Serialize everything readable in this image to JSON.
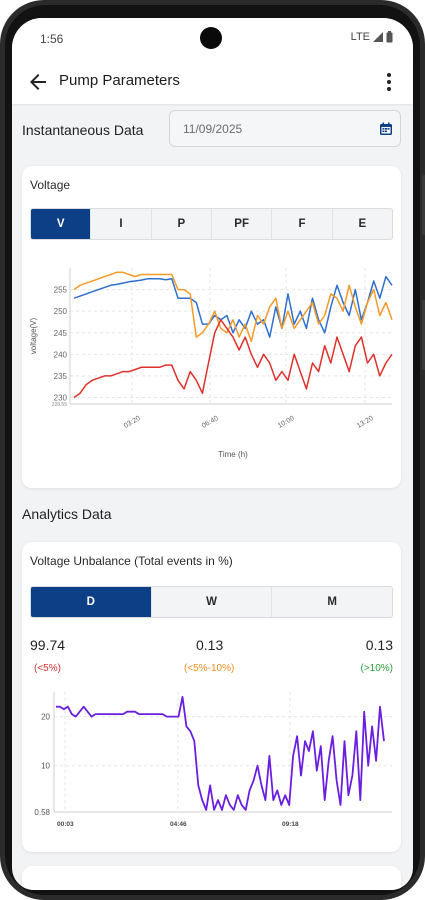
{
  "status_bar": {
    "time": "1:56",
    "network": "LTE"
  },
  "app_bar": {
    "title": "Pump Parameters",
    "back_icon": "arrow-left-icon",
    "menu_icon": "more-vert-icon"
  },
  "instantaneous": {
    "label": "Instantaneous Data",
    "date_value": "11/09/2025",
    "date_icon": "calendar-icon"
  },
  "voltage_card": {
    "title": "Voltage",
    "tabs": [
      "V",
      "I",
      "P",
      "PF",
      "F",
      "E"
    ],
    "active_tab": "V"
  },
  "analytics": {
    "label": "Analytics Data",
    "card_title": "Voltage Unbalance (Total events in %)",
    "tabs": [
      "D",
      "W",
      "M"
    ],
    "active_tab": "D",
    "stats": [
      {
        "value": "99.74",
        "label": "(<5%)",
        "color": "#d32f2f"
      },
      {
        "value": "0.13",
        "label": "(<5%-10%)",
        "color": "#ef8c1e"
      },
      {
        "value": "0.13",
        "label": "(>10%)",
        "color": "#2e9e3a"
      }
    ]
  },
  "chart_data": [
    {
      "type": "line",
      "title": "",
      "xlabel": "Time (h)",
      "ylabel": "voltage(V)",
      "x_tick_labels": [
        "03:20",
        "06:40",
        "10:00",
        "13:20"
      ],
      "y_tick_labels": [
        "230",
        "235",
        "240",
        "245",
        "250",
        "255"
      ],
      "y_min_label": "228.55",
      "ylim": [
        228.5,
        260
      ],
      "grid": true,
      "series": [
        {
          "color": "#2f6fce",
          "values": [
            253,
            253.5,
            254,
            254.5,
            255,
            255.5,
            256,
            256.2,
            256.5,
            256.8,
            257,
            257.2,
            257.5,
            257.5,
            257.5,
            257.3,
            257.5,
            253,
            253,
            253,
            252,
            247,
            247,
            249,
            248,
            249,
            245,
            248,
            246,
            250,
            247,
            248,
            244,
            251,
            246,
            254,
            247,
            250,
            246,
            253,
            248,
            245,
            251,
            256,
            252,
            249,
            255,
            248,
            252,
            257,
            253,
            258,
            256
          ]
        },
        {
          "color": "#f39a28",
          "values": [
            255,
            256,
            256.5,
            257,
            257.5,
            258,
            258.5,
            259,
            259,
            258.5,
            258,
            258.5,
            258.5,
            258.5,
            258.5,
            258.5,
            258.5,
            255,
            255,
            254,
            244,
            245,
            247,
            250,
            246,
            245,
            248,
            244,
            247,
            243,
            249,
            247,
            251,
            253,
            246,
            250,
            246,
            248,
            250,
            252,
            247,
            249,
            254,
            253,
            250,
            256,
            251,
            247,
            252,
            255,
            249,
            252,
            248
          ]
        },
        {
          "color": "#e0302b",
          "values": [
            230,
            231,
            233,
            234,
            234.5,
            235,
            235,
            235.5,
            236,
            236,
            236.5,
            237,
            237,
            237,
            237,
            237.5,
            237.5,
            234,
            232,
            236,
            234,
            231,
            238,
            245,
            248,
            246,
            244,
            241,
            244,
            240,
            237,
            240,
            238,
            234,
            236,
            234,
            240,
            236,
            232,
            238,
            236,
            242,
            238,
            244,
            240,
            236,
            242,
            244,
            238,
            240,
            235,
            238,
            240
          ]
        }
      ]
    },
    {
      "type": "line",
      "title": "",
      "xlabel": "",
      "ylabel": "",
      "x_tick_labels": [
        "00:03",
        "04:46",
        "09:18"
      ],
      "y_tick_labels": [
        "0.58",
        "10",
        "20"
      ],
      "ylim": [
        0.58,
        25
      ],
      "grid": true,
      "series": [
        {
          "color": "#6a1fe0",
          "values": [
            22,
            22,
            21.5,
            22,
            20.5,
            20,
            21,
            22,
            21,
            20,
            20.5,
            20.5,
            20.5,
            20.5,
            20.5,
            20.5,
            20.5,
            20.5,
            21,
            21,
            21,
            20.5,
            20.5,
            20.5,
            20.5,
            20.5,
            20.5,
            20.5,
            20,
            20,
            20,
            20,
            24,
            18,
            17,
            15,
            6,
            3,
            1,
            6,
            1,
            3,
            1,
            4,
            2,
            1,
            4,
            2,
            1,
            5,
            7,
            10,
            6,
            3,
            12,
            3,
            5,
            2,
            4,
            2,
            12,
            16,
            8,
            15,
            13,
            17,
            9,
            14,
            3,
            11,
            16,
            7,
            2,
            15,
            4,
            8,
            17,
            3,
            21,
            10,
            18,
            11,
            22,
            15
          ]
        }
      ]
    }
  ]
}
